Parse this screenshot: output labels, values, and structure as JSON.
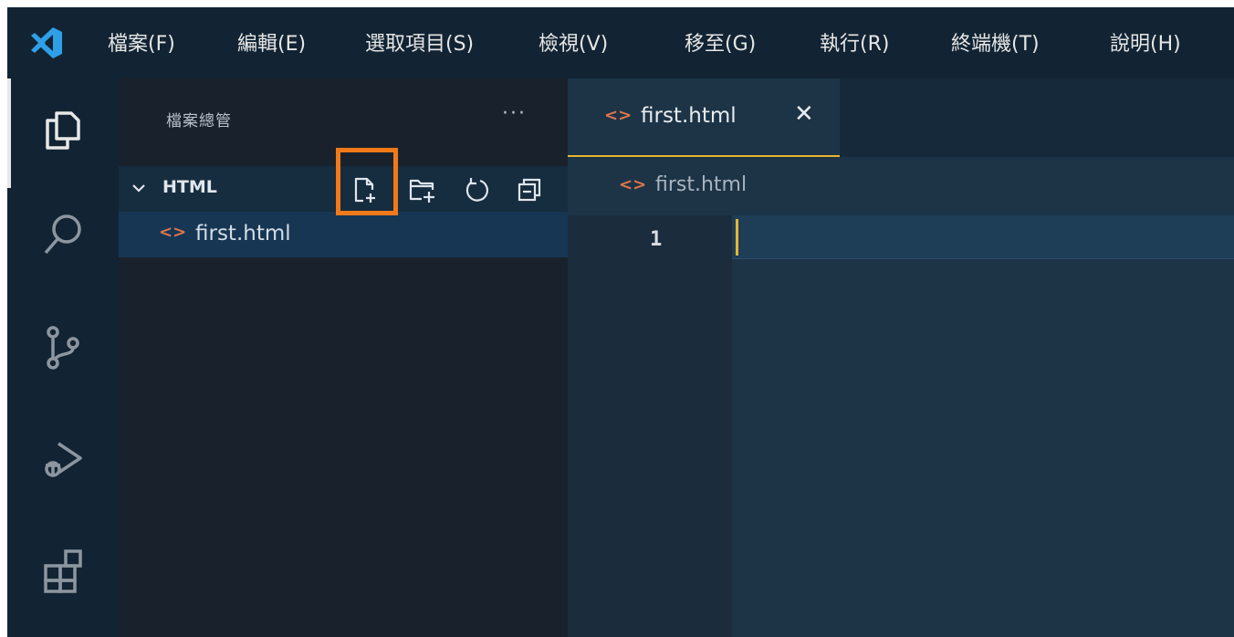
{
  "menu": {
    "items": [
      "檔案(F)",
      "編輯(E)",
      "選取項目(S)",
      "檢視(V)",
      "移至(G)",
      "執行(R)",
      "終端機(T)",
      "說明(H)"
    ]
  },
  "activity_bar": {
    "icons": [
      "explorer-icon",
      "search-icon",
      "source-control-icon",
      "run-debug-icon",
      "extensions-icon"
    ]
  },
  "sidebar": {
    "title": "檔案總管",
    "more": "···",
    "section": {
      "title": "HTML",
      "actions": [
        "new-file-icon",
        "new-folder-icon",
        "refresh-icon",
        "collapse-all-icon"
      ]
    },
    "files": [
      {
        "tag": "<>",
        "name": "first.html"
      }
    ]
  },
  "editor": {
    "tab": {
      "tag": "<>",
      "label": "first.html",
      "close": "✕"
    },
    "breadcrumb": {
      "tag": "<>",
      "label": "first.html"
    },
    "line_numbers": [
      "1"
    ]
  },
  "colors": {
    "accent_highlight": "#f07a1a",
    "html_tag": "#e0764b",
    "cursor": "#e8b531",
    "logo": "#2f9fe8"
  }
}
